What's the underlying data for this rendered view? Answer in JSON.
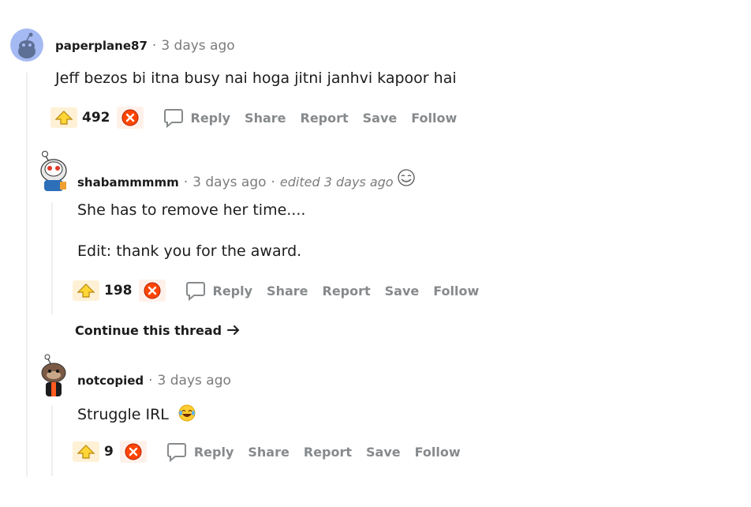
{
  "comments": [
    {
      "username": "paperplane87",
      "time": "3 days ago",
      "body": "Jeff bezos bi itna busy nai hoga jitni janhvi kapoor hai",
      "score": "492"
    },
    {
      "username": "shabammmmm",
      "time": "3 days ago",
      "edited": "edited 3 days ago",
      "body_lines": [
        "She has to remove her time....",
        "Edit: thank you for the award."
      ],
      "score": "198"
    },
    {
      "username": "notcopied",
      "time": "3 days ago",
      "body": "Struggle IRL",
      "score": "9"
    }
  ],
  "actions": {
    "reply": "Reply",
    "share": "Share",
    "report": "Report",
    "save": "Save",
    "follow": "Follow"
  },
  "continue_thread": "Continue this thread",
  "separator": "·",
  "icons": {
    "upvote": "award-upvote-icon",
    "downvote": "award-downvote-icon",
    "reply": "speech-bubble-icon",
    "arrow": "arrow-right-icon",
    "emoji": "laughing-tears-emoji",
    "edit": "awesome-face-award-icon"
  },
  "colors": {
    "upvote": "#ffd635",
    "downvote": "#ff4500",
    "thread_line": "#edeff1",
    "meta": "#7c7c7c",
    "action": "#878a8c"
  }
}
